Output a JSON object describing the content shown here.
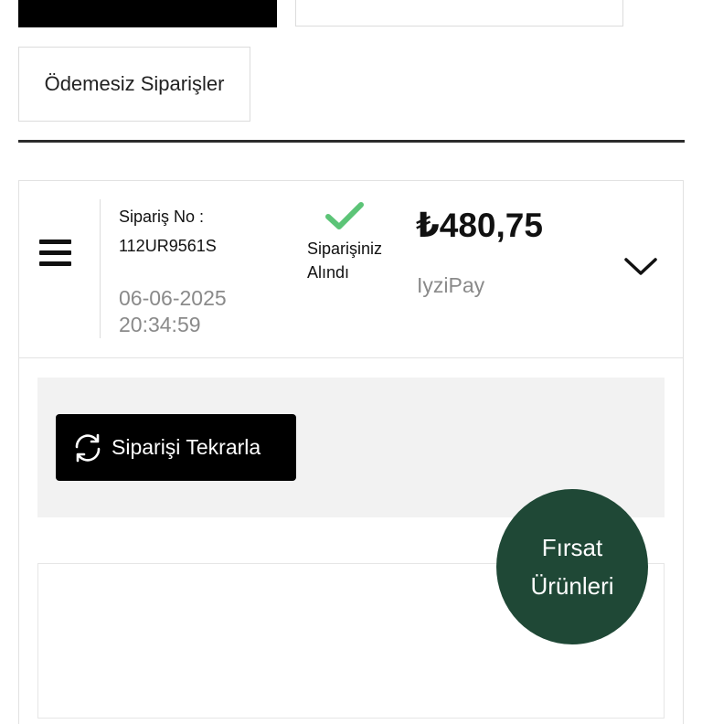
{
  "tabs": {
    "unpaid_orders": "Ödemesiz Siparişler"
  },
  "order": {
    "number_label": "Sipariş No :",
    "number": "112UR9561S",
    "date": "06-06-2025",
    "time": "20:34:59",
    "status_line1": "Siparişiniz",
    "status_line2": "Alındı",
    "price": "₺480,75",
    "payment_method": "IyziPay"
  },
  "actions": {
    "reorder_label": "Siparişi Tekrarla"
  },
  "fab": {
    "line1": "Fırsat",
    "line2": "Ürünleri"
  },
  "icons": {
    "menu": "menu-icon",
    "status": "check-icon",
    "expand": "chevron-down-icon",
    "reorder": "refresh-icon"
  },
  "colors": {
    "status_check": "#5cc477",
    "fab_background": "#1f4836",
    "muted_text": "#8a8a8a",
    "button_background": "#000000",
    "panel_background": "#f2f2f2"
  }
}
